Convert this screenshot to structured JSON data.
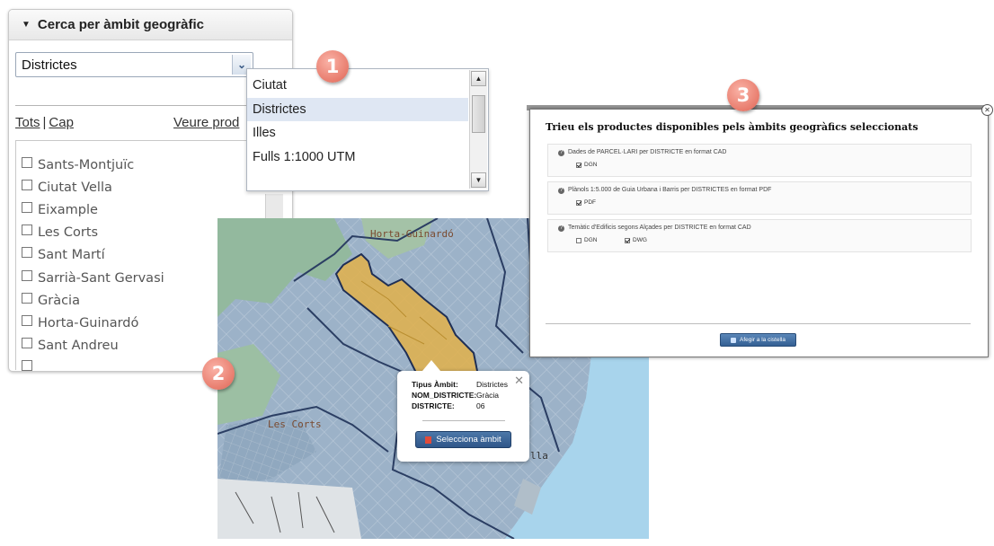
{
  "panel": {
    "title": "Cerca per àmbit geogràfic",
    "select_value": "Districtes",
    "links": {
      "all": "Tots",
      "none": "Cap",
      "view": "Veure prod"
    },
    "items": [
      "Sants-Montjuïc",
      "Ciutat Vella",
      "Eixample",
      "Les Corts",
      "Sant Martí",
      "Sarrià-Sant Gervasi",
      "Gràcia",
      "Horta-Guinardó",
      "Sant Andreu"
    ]
  },
  "dropdown": {
    "options": [
      "Ciutat",
      "Districtes",
      "Illes",
      "Fulls 1:1000 UTM"
    ],
    "selected": "Districtes"
  },
  "badges": [
    "1",
    "2",
    "3"
  ],
  "map": {
    "labels": {
      "horta": "Horta-Guinardó",
      "corts": "Les Corts",
      "illa": "lla"
    },
    "popup": {
      "rows": [
        {
          "key": "Tipus Àmbit:",
          "value": "Districtes"
        },
        {
          "key": "NOM_DISTRICTE:",
          "value": "Gràcia"
        },
        {
          "key": "DISTRICTE:",
          "value": "06"
        }
      ],
      "button": "Selecciona àmbit"
    },
    "colors": {
      "water": "#a7d4ee",
      "land": "#98aec4",
      "park": "#8db89a",
      "selected": "#e2b04a"
    }
  },
  "dialog": {
    "title": "Trieu els productes disponibles pels àmbits geogràfics seleccionats",
    "products": [
      {
        "title": "Dades de PARCEL·LARI per DISTRICTE en format CAD",
        "formats": [
          {
            "label": "DGN",
            "checked": true
          }
        ]
      },
      {
        "title": "Plànols 1:5.000 de Guia Urbana i Barris per DISTRICTES en format PDF",
        "formats": [
          {
            "label": "PDF",
            "checked": true
          }
        ]
      },
      {
        "title": "Temàtic d'Edificis segons Alçades per DISTRICTE en format CAD",
        "formats": [
          {
            "label": "DGN",
            "checked": false
          },
          {
            "label": "DWG",
            "checked": true
          }
        ]
      }
    ],
    "button": "Afegir a la cistella"
  }
}
